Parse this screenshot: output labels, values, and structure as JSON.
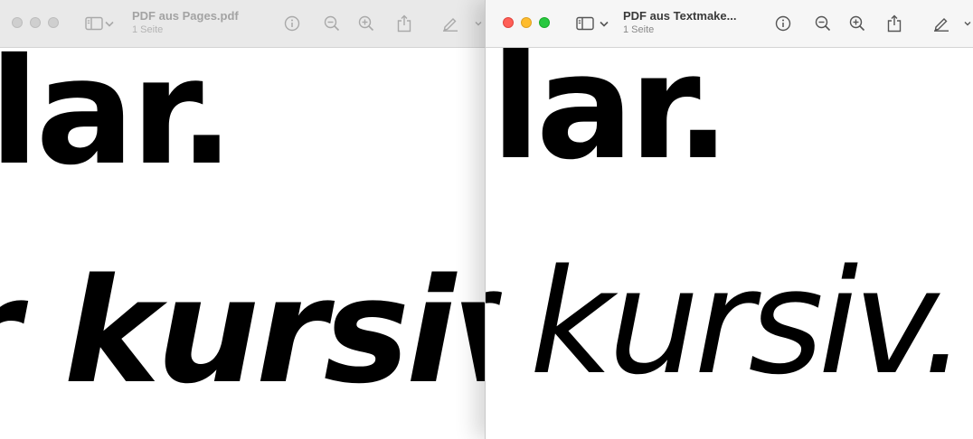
{
  "windows": [
    {
      "title": "PDF aus Pages.pdf",
      "subtitle": "1 Seite",
      "focused": false,
      "page_lines": [
        "lar.",
        "r kursiv."
      ]
    },
    {
      "title": "PDF aus Textmake...",
      "subtitle": "1 Seite",
      "focused": true,
      "page_lines": [
        "lar.",
        "r kursiv."
      ]
    }
  ],
  "toolbar_icons": [
    "sidebar-toggle-icon",
    "chevron-down-icon",
    "info-icon",
    "zoom-out-icon",
    "zoom-in-icon",
    "share-icon",
    "markup-pen-icon"
  ],
  "colors": {
    "close": "#ff5f57",
    "minimize": "#febc2e",
    "zoom": "#28c840",
    "inactive_light": "#cfcfcf",
    "icon_inactive": "#a9a9a9",
    "icon_active": "#555555"
  }
}
